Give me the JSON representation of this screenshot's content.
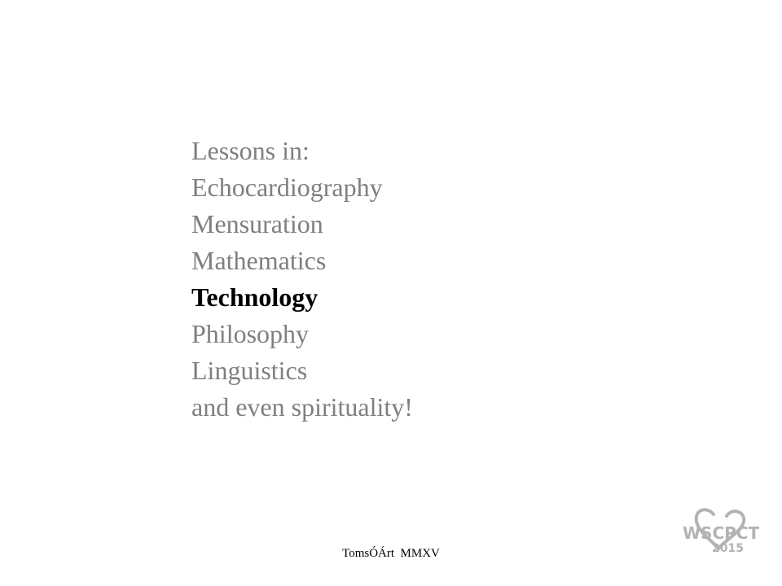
{
  "slide": {
    "lessons": [
      {
        "label": "Lessons in:"
      },
      {
        "label": "Echocardiography"
      },
      {
        "label": "Mensuration"
      },
      {
        "label": "Mathematics"
      },
      {
        "label": "Technology"
      },
      {
        "label": "Philosophy"
      },
      {
        "label": "Linguistics"
      },
      {
        "label": "and even spirituality!"
      }
    ],
    "highlighted_item": "Technology",
    "footer": "TomsÓÁrt  MMXV",
    "logo": {
      "text": "WSCPCT",
      "year": "2015",
      "color": "#b3b3b3"
    }
  },
  "colors": {
    "text_muted": "#7f7f7f",
    "text_highlight": "#000000",
    "background": "#ffffff"
  }
}
